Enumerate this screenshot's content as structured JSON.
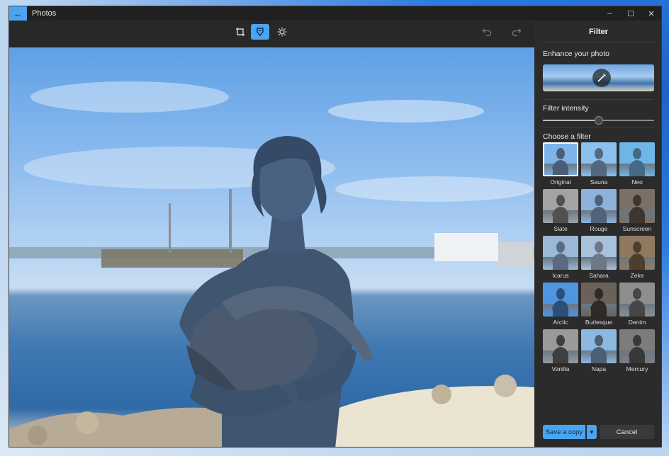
{
  "window": {
    "title": "Photos"
  },
  "window_controls": {
    "minimize": "–",
    "maximize": "☐",
    "close": "✕"
  },
  "toolbar": {
    "tools": [
      {
        "name": "crop-icon",
        "active": false
      },
      {
        "name": "filter-icon",
        "active": true
      },
      {
        "name": "adjust-brightness-icon",
        "active": false
      }
    ],
    "undo_icon": "undo-icon",
    "redo_icon": "redo-icon"
  },
  "panel": {
    "title": "Filter",
    "enhance_label": "Enhance your photo",
    "intensity_label": "Filter intensity",
    "intensity_value": 50,
    "choose_label": "Choose a filter",
    "filters": [
      {
        "label": "Original",
        "tint": "#7fb4ea",
        "fig": "#4a5e78",
        "selected": true
      },
      {
        "label": "Sauna",
        "tint": "#8cc0ee",
        "fig": "#54687f"
      },
      {
        "label": "Neo",
        "tint": "#6fb6e8",
        "fig": "#456a86"
      },
      {
        "label": "Slate",
        "tint": "#a3a3a3",
        "fig": "#505050"
      },
      {
        "label": "Rouge",
        "tint": "#8eb3db",
        "fig": "#53627a"
      },
      {
        "label": "Sunscreen",
        "tint": "#7a7065",
        "fig": "#3d362f"
      },
      {
        "label": "Icarus",
        "tint": "#9bb8d6",
        "fig": "#5a6b80"
      },
      {
        "label": "Sahara",
        "tint": "#a9c2dc",
        "fig": "#6f7884"
      },
      {
        "label": "Zeke",
        "tint": "#8f7a60",
        "fig": "#4e3e2c"
      },
      {
        "label": "Arctic",
        "tint": "#4f95e0",
        "fig": "#2c4f79"
      },
      {
        "label": "Burlesque",
        "tint": "#6a6259",
        "fig": "#302a25"
      },
      {
        "label": "Denim",
        "tint": "#8e8e8e",
        "fig": "#474747"
      },
      {
        "label": "Vanilla",
        "tint": "#9a9a9a",
        "fig": "#3f3f3f"
      },
      {
        "label": "Napa",
        "tint": "#8cb8e2",
        "fig": "#4d5f73"
      },
      {
        "label": "Mercury",
        "tint": "#7c7c7c",
        "fig": "#383838"
      }
    ],
    "save_label": "Save a copy",
    "cancel_label": "Cancel"
  },
  "colors": {
    "accent": "#4aa4f0",
    "window_bg": "#202020",
    "panel_bg": "#2b2b2b"
  }
}
